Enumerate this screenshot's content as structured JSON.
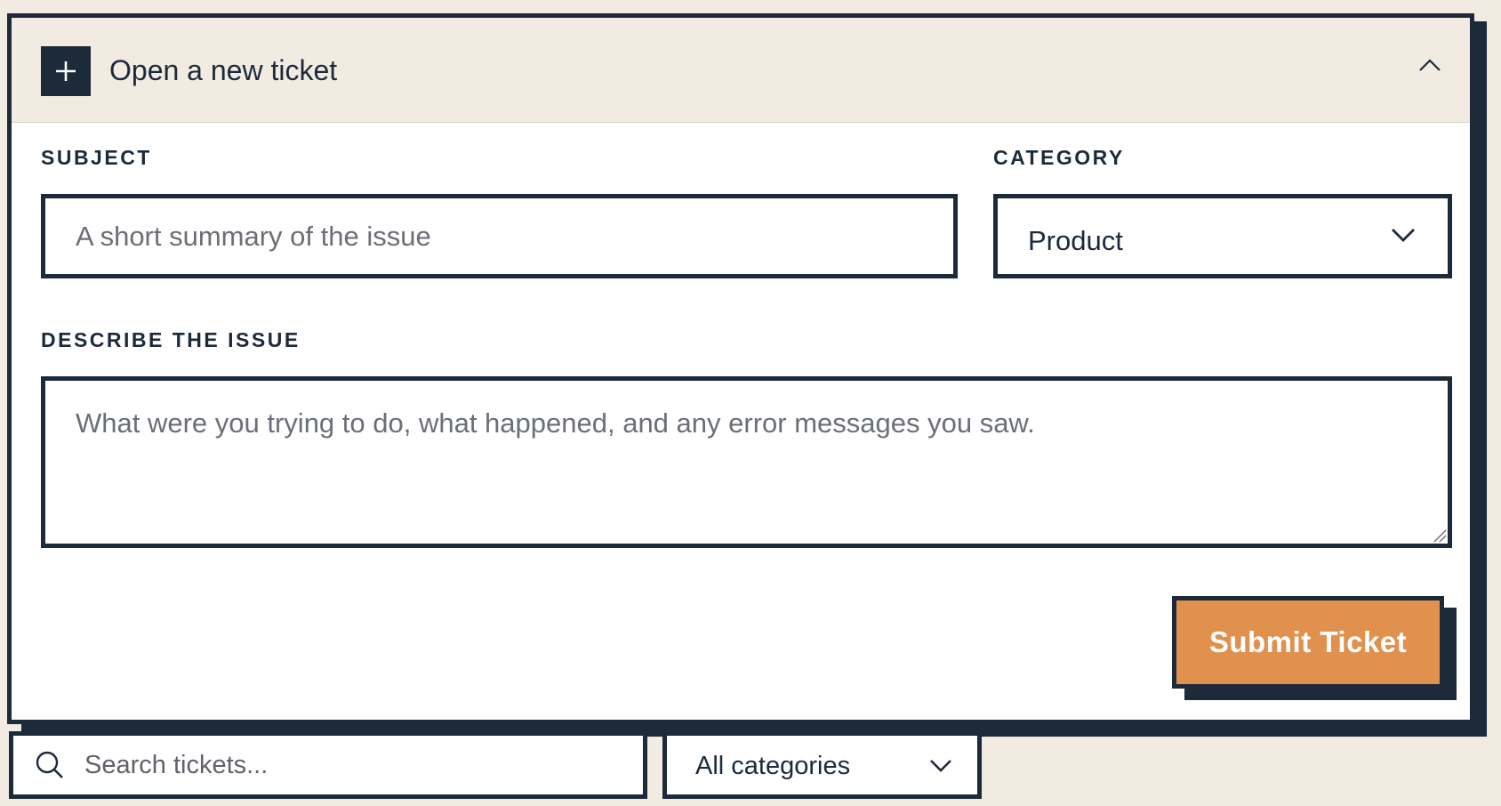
{
  "ticket_panel": {
    "title": "Open a new ticket",
    "subject": {
      "label": "SUBJECT",
      "placeholder": "A short summary of the issue",
      "value": ""
    },
    "category": {
      "label": "CATEGORY",
      "selected": "Product"
    },
    "description": {
      "label": "DESCRIBE THE ISSUE",
      "placeholder": "What were you trying to do, what happened, and any error messages you saw.",
      "value": ""
    },
    "submit_label": "Submit Ticket"
  },
  "filters": {
    "search_placeholder": "Search tickets...",
    "category_selected": "All categories"
  },
  "icons": {
    "add": "plus-icon",
    "collapse": "chevron-up-icon",
    "dropdown": "chevron-down-icon",
    "search": "search-icon",
    "resize": "resize-grip-icon"
  },
  "colors": {
    "ink": "#1c2a3a",
    "page_bg": "#f1ebe2",
    "accent": "#e0914d",
    "placeholder": "#6b6f76"
  }
}
